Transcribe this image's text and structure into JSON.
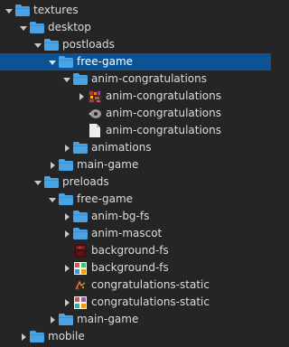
{
  "colors": {
    "background": "#252526",
    "selected": "#0b5394",
    "folder": "#4aa3e6",
    "text": "#dcdcdc"
  },
  "tree": {
    "items": [
      {
        "label": "textures",
        "kind": "folder",
        "state": "expanded"
      },
      {
        "label": "desktop",
        "kind": "folder",
        "state": "expanded"
      },
      {
        "label": "postloads",
        "kind": "folder",
        "state": "expanded"
      },
      {
        "label": "free-game",
        "kind": "folder",
        "state": "expanded",
        "selected": true
      },
      {
        "label": "anim-congratulations",
        "kind": "folder",
        "state": "expanded"
      },
      {
        "label": "anim-congratulations",
        "kind": "image-sprite-icon",
        "state": "collapsed"
      },
      {
        "label": "anim-congratulations",
        "kind": "animation-gear-icon",
        "state": "none"
      },
      {
        "label": "anim-congratulations",
        "kind": "file-icon",
        "state": "none"
      },
      {
        "label": "animations",
        "kind": "folder",
        "state": "collapsed"
      },
      {
        "label": "main-game",
        "kind": "folder",
        "state": "collapsed"
      },
      {
        "label": "preloads",
        "kind": "folder",
        "state": "expanded"
      },
      {
        "label": "free-game",
        "kind": "folder",
        "state": "expanded"
      },
      {
        "label": "anim-bg-fs",
        "kind": "folder",
        "state": "collapsed"
      },
      {
        "label": "anim-mascot",
        "kind": "folder",
        "state": "collapsed"
      },
      {
        "label": "background-fs",
        "kind": "image-dark-icon",
        "state": "none"
      },
      {
        "label": "background-fs",
        "kind": "image-sprite-icon",
        "state": "collapsed"
      },
      {
        "label": "congratulations-static",
        "kind": "image-small-icon",
        "state": "none"
      },
      {
        "label": "congratulations-static",
        "kind": "image-sprite-icon",
        "state": "collapsed"
      },
      {
        "label": "main-game",
        "kind": "folder",
        "state": "collapsed"
      },
      {
        "label": "mobile",
        "kind": "folder",
        "state": "collapsed"
      }
    ]
  }
}
